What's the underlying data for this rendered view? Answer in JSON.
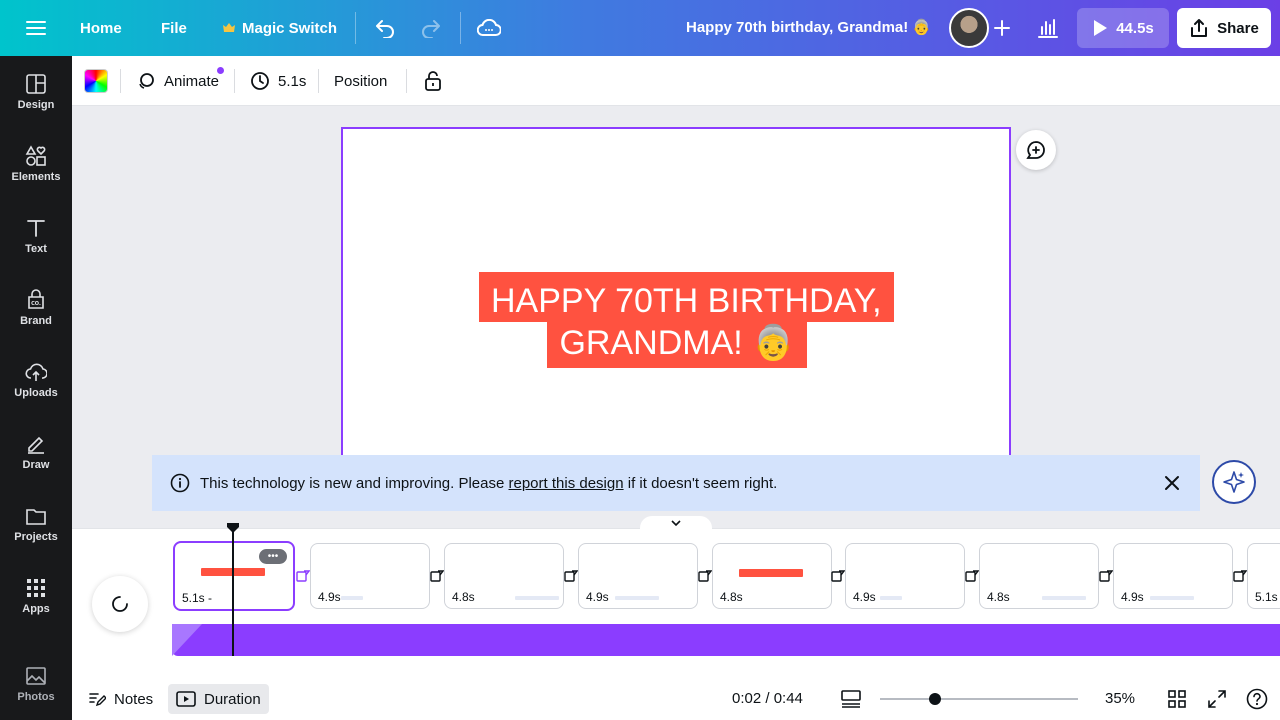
{
  "topbar": {
    "home_label": "Home",
    "file_label": "File",
    "magic_switch_label": "Magic Switch",
    "doc_title": "Happy 70th birthday, Grandma! 👵",
    "play_label": "44.5s",
    "share_label": "Share"
  },
  "sidebar": {
    "items": [
      {
        "label": "Design",
        "icon": "layout-icon"
      },
      {
        "label": "Elements",
        "icon": "shapes-icon"
      },
      {
        "label": "Text",
        "icon": "text-icon"
      },
      {
        "label": "Brand",
        "icon": "brand-icon"
      },
      {
        "label": "Uploads",
        "icon": "cloud-upload-icon"
      },
      {
        "label": "Draw",
        "icon": "pen-icon"
      },
      {
        "label": "Projects",
        "icon": "folder-icon"
      },
      {
        "label": "Apps",
        "icon": "grid-icon"
      },
      {
        "label": "Photos",
        "icon": "image-icon"
      }
    ]
  },
  "toolbar": {
    "animate_label": "Animate",
    "timing_label": "5.1s",
    "position_label": "Position"
  },
  "canvas": {
    "headline_line1": "HAPPY 70TH BIRTHDAY,",
    "headline_line2": "GRANDMA! 👵"
  },
  "notice": {
    "text_before": "This technology is new and improving. Please ",
    "link_text": "report this design",
    "text_after": " if it doesn't seem right."
  },
  "timeline": {
    "pages": [
      {
        "duration": "5.1s -",
        "mini": "HAPPY 70TH BIRTHDAY, GRANDMA! 👵",
        "selected": true
      },
      {
        "duration": "4.9s"
      },
      {
        "duration": "4.8s"
      },
      {
        "duration": "4.9s"
      },
      {
        "duration": "4.8s"
      },
      {
        "duration": "4.9s"
      },
      {
        "duration": "4.8s"
      },
      {
        "duration": "4.9s"
      },
      {
        "duration": "5.1s"
      }
    ]
  },
  "footer": {
    "notes_label": "Notes",
    "duration_label": "Duration",
    "timecode": "0:02 / 0:44",
    "zoom_percent": "35%",
    "zoom_level": 0.28
  },
  "colors": {
    "accent": "#8b3dff",
    "headline_bg": "#ff5240",
    "notice_bg": "#d4e3fc"
  }
}
